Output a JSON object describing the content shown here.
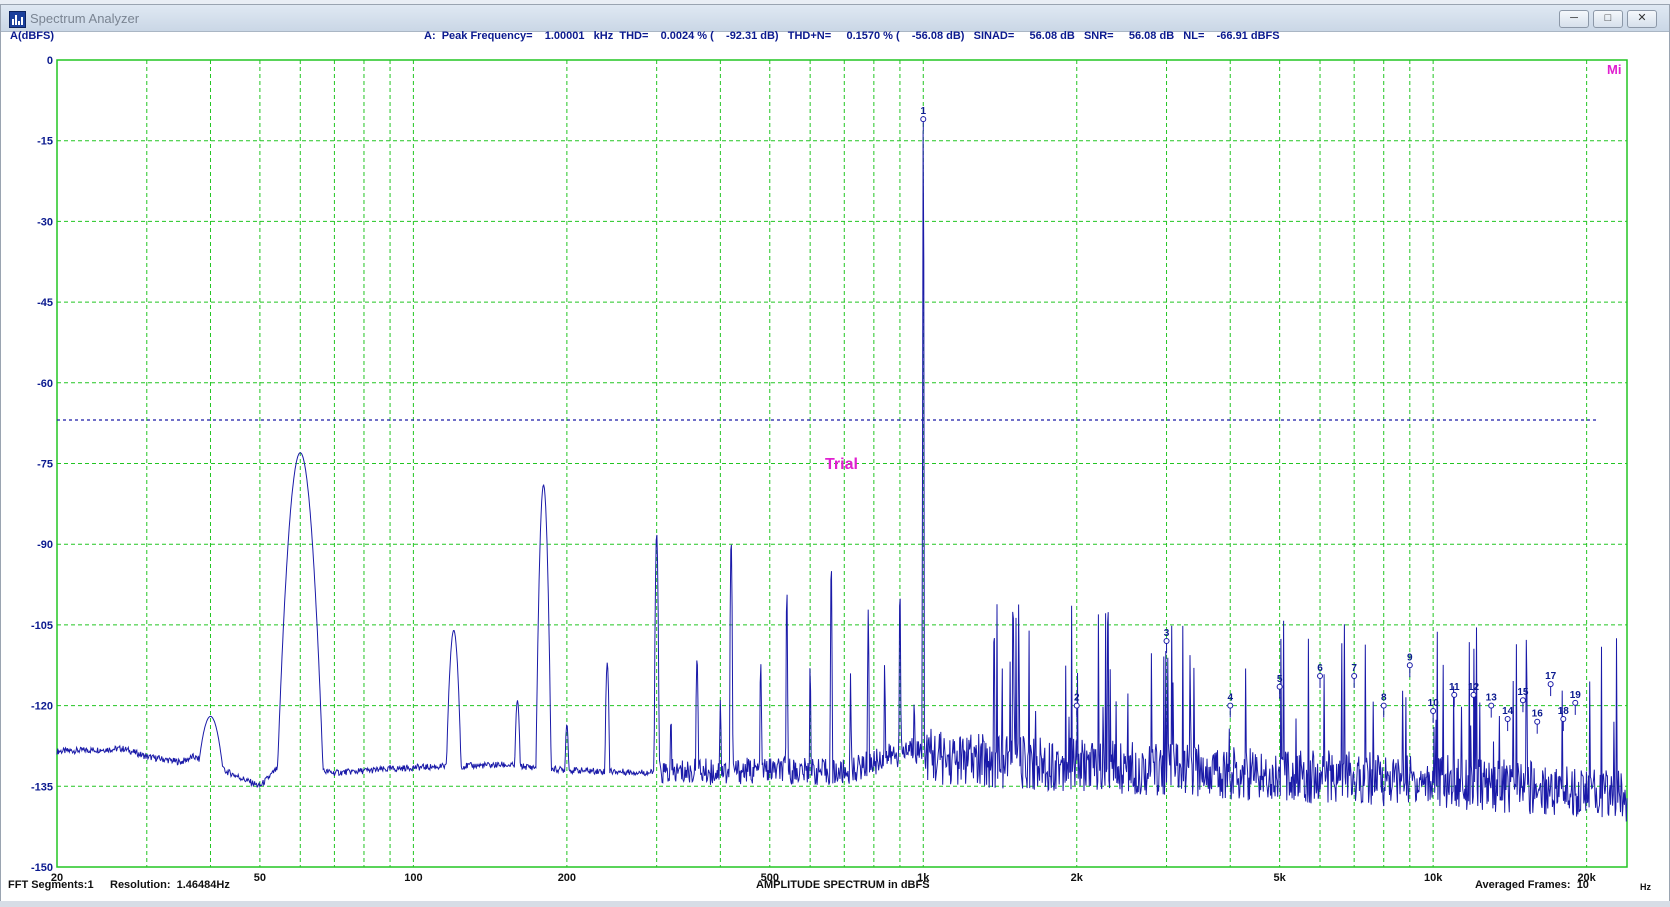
{
  "window": {
    "title": "Spectrum Analyzer",
    "controls": [
      "minimize",
      "maximize",
      "close"
    ]
  },
  "readout": {
    "ylabel": "A(dBFS)",
    "text": "A:  Peak Frequency=    1.00001   kHz  THD=    0.0024 % (    -92.31 dB)   THD+N=     0.1570 % (    -56.08 dB)   SINAD=     56.08 dB   SNR=     56.08 dB   NL=    -66.91 dBFS"
  },
  "footer": {
    "fft_segments": "FFT Segments:1",
    "resolution": "Resolution:  1.46484Hz",
    "center_label": "AMPLITUDE SPECTRUM in dBFS",
    "averaged_frames": "Averaged Frames:  10",
    "unit": "Hz"
  },
  "colors": {
    "grid": "#22c522",
    "trace": "#1a1aa8",
    "axis_text": "#0b1a8f",
    "watermark": "#e020d0",
    "noise_line": "#1a1aa8"
  },
  "chart_data": {
    "type": "line",
    "xscale": "log",
    "xlim": [
      20,
      24000
    ],
    "ylim": [
      -150,
      0
    ],
    "xlabel": "Hz",
    "ylabel": "A(dBFS)",
    "x_ticks": [
      {
        "v": 20,
        "label": "20"
      },
      {
        "v": 50,
        "label": "50"
      },
      {
        "v": 100,
        "label": "100"
      },
      {
        "v": 200,
        "label": "200"
      },
      {
        "v": 500,
        "label": "500"
      },
      {
        "v": 1000,
        "label": "1k"
      },
      {
        "v": 2000,
        "label": "2k"
      },
      {
        "v": 5000,
        "label": "5k"
      },
      {
        "v": 10000,
        "label": "10k"
      },
      {
        "v": 20000,
        "label": "20k"
      }
    ],
    "y_ticks": [
      0,
      -15,
      -30,
      -45,
      -60,
      -75,
      -90,
      -105,
      -120,
      -135,
      -150
    ],
    "grid": true,
    "noise_level_dbfs": -66.91,
    "watermark": "Trial",
    "corner_mark": "Mi",
    "noise_floor": [
      [
        20,
        -128.5
      ],
      [
        27,
        -128
      ],
      [
        30,
        -129.5
      ],
      [
        35,
        -130.5
      ],
      [
        37,
        -129.5
      ],
      [
        50,
        -135
      ],
      [
        55,
        -131
      ],
      [
        70,
        -132.5
      ],
      [
        100,
        -131.5
      ],
      [
        150,
        -131
      ],
      [
        200,
        -132
      ],
      [
        300,
        -132.5
      ],
      [
        500,
        -132
      ],
      [
        700,
        -132.5
      ],
      [
        950,
        -128
      ],
      [
        1100,
        -130
      ],
      [
        2000,
        -131
      ],
      [
        5000,
        -133
      ],
      [
        10000,
        -134
      ],
      [
        20000,
        -136
      ],
      [
        24000,
        -137
      ]
    ],
    "peaks": [
      {
        "f": 40,
        "db": -122,
        "w": 0.06
      },
      {
        "f": 60,
        "db": -73,
        "w": 0.045
      },
      {
        "f": 120,
        "db": -106,
        "w": 0.022
      },
      {
        "f": 160,
        "db": -119,
        "w": 0.012
      },
      {
        "f": 180,
        "db": -79,
        "w": 0.016
      },
      {
        "f": 200,
        "db": -123.5,
        "w": 0.01
      },
      {
        "f": 240,
        "db": -112,
        "w": 0.008
      },
      {
        "f": 300,
        "db": -88,
        "w": 0.006
      },
      {
        "f": 320,
        "db": -122,
        "w": 0.004
      },
      {
        "f": 360,
        "db": -111,
        "w": 0.005
      },
      {
        "f": 400,
        "db": -119,
        "w": 0.004
      },
      {
        "f": 420,
        "db": -89,
        "w": 0.004
      },
      {
        "f": 480,
        "db": -112,
        "w": 0.004
      },
      {
        "f": 540,
        "db": -98,
        "w": 0.003
      },
      {
        "f": 600,
        "db": -112,
        "w": 0.003
      },
      {
        "f": 660,
        "db": -93,
        "w": 0.003
      },
      {
        "f": 720,
        "db": -114,
        "w": 0.003
      },
      {
        "f": 780,
        "db": -102,
        "w": 0.003
      },
      {
        "f": 840,
        "db": -112,
        "w": 0.003
      },
      {
        "f": 900,
        "db": -98,
        "w": 0.003
      },
      {
        "f": 960,
        "db": -118,
        "w": 0.003
      },
      {
        "f": 1000,
        "db": -11,
        "w": 0.0015
      },
      {
        "f": 1500,
        "db": -97,
        "w": 0.002
      },
      {
        "f": 2300,
        "db": -104,
        "w": 0.002
      }
    ],
    "markers": [
      {
        "label": "1",
        "f": 1000,
        "db": -11
      },
      {
        "label": "2",
        "f": 2000,
        "db": -120
      },
      {
        "label": "3",
        "f": 3000,
        "db": -108
      },
      {
        "label": "4",
        "f": 4000,
        "db": -120
      },
      {
        "label": "5",
        "f": 5000,
        "db": -116.5
      },
      {
        "label": "6",
        "f": 6000,
        "db": -114.5
      },
      {
        "label": "7",
        "f": 7000,
        "db": -114.5
      },
      {
        "label": "8",
        "f": 8000,
        "db": -120
      },
      {
        "label": "9",
        "f": 9000,
        "db": -112.5
      },
      {
        "label": "10",
        "f": 10000,
        "db": -121
      },
      {
        "label": "11",
        "f": 11000,
        "db": -118
      },
      {
        "label": "12",
        "f": 12000,
        "db": -118
      },
      {
        "label": "13",
        "f": 13000,
        "db": -120
      },
      {
        "label": "14",
        "f": 14000,
        "db": -122.5
      },
      {
        "label": "15",
        "f": 15000,
        "db": -119
      },
      {
        "label": "16",
        "f": 16000,
        "db": -123
      },
      {
        "label": "17",
        "f": 17000,
        "db": -116
      },
      {
        "label": "18",
        "f": 18000,
        "db": -122.5
      },
      {
        "label": "19",
        "f": 19000,
        "db": -119.5
      }
    ]
  }
}
